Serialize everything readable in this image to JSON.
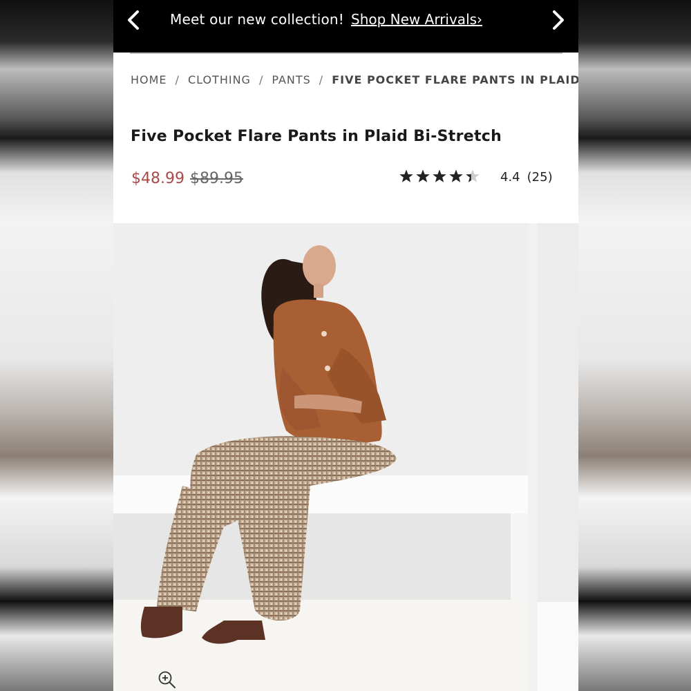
{
  "promo": {
    "message": "Meet our new collection!",
    "link_label": "Shop New Arrivals›",
    "prev_icon": "chevron-left-icon",
    "next_icon": "chevron-right-icon"
  },
  "breadcrumb": {
    "items": [
      "HOME",
      "CLOTHING",
      "PANTS"
    ],
    "separator": "/",
    "current": "FIVE POCKET FLARE PANTS IN PLAID BI…"
  },
  "product": {
    "title": "Five Pocket Flare Pants in Plaid Bi-Stretch",
    "sale_price": "$48.99",
    "original_price": "$89.95",
    "rating_value": "4.4",
    "rating_fraction": 0.88,
    "review_count": "(25)"
  },
  "gallery": {
    "zoom_icon": "zoom-in-icon"
  },
  "colors": {
    "promo_bg": "#000000",
    "sale_price": "#a84a4a",
    "star_fill": "#222222",
    "star_empty": "#cccccc"
  }
}
